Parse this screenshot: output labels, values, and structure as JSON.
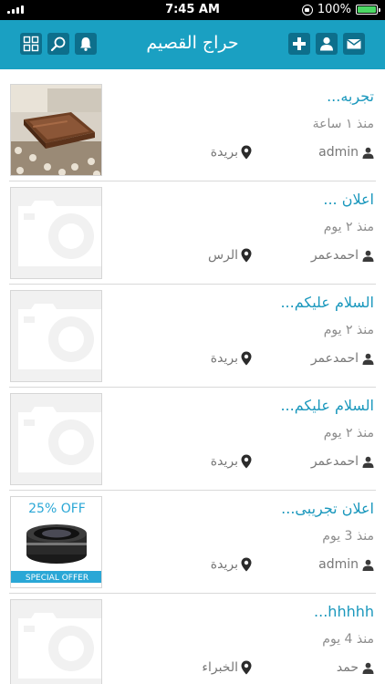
{
  "status": {
    "time": "7:45 AM",
    "battery": "100%"
  },
  "header": {
    "title": "حراج القصيم"
  },
  "icons": {
    "mail": "mail-icon",
    "user": "user-icon",
    "add": "plus-icon",
    "bell": "bell-icon",
    "search": "search-icon",
    "grid": "grid-icon"
  },
  "colors": {
    "header": "#1aa0c2",
    "button": "#0d6f8c",
    "title_text": "#1b98bd"
  },
  "listings": [
    {
      "title": "تجربه...",
      "ago": "منذ ١ ساعة",
      "author": "admin",
      "location": "بريدة",
      "image": "furniture-photo"
    },
    {
      "title": "اعلان ...",
      "ago": "منذ ٢ يوم",
      "author": "احمدعمر",
      "location": "الرس",
      "image": "camera-placeholder"
    },
    {
      "title": "السلام عليكم...",
      "ago": "منذ ٢ يوم",
      "author": "احمدعمر",
      "location": "بريدة",
      "image": "camera-placeholder"
    },
    {
      "title": "السلام عليكم...",
      "ago": "منذ ٢ يوم",
      "author": "احمدعمر",
      "location": "بريدة",
      "image": "camera-placeholder"
    },
    {
      "title": "اعلان تجريبى...",
      "ago": "منذ 3 يوم",
      "author": "admin",
      "location": "بريدة",
      "image": "lens-offer",
      "offer_top": "25% OFF",
      "offer_bottom": "SPECIAL OFFER"
    },
    {
      "title": "hhhhh...",
      "ago": "منذ 4 يوم",
      "author": "حمد",
      "location": "الخبراء",
      "image": "camera-placeholder"
    }
  ]
}
